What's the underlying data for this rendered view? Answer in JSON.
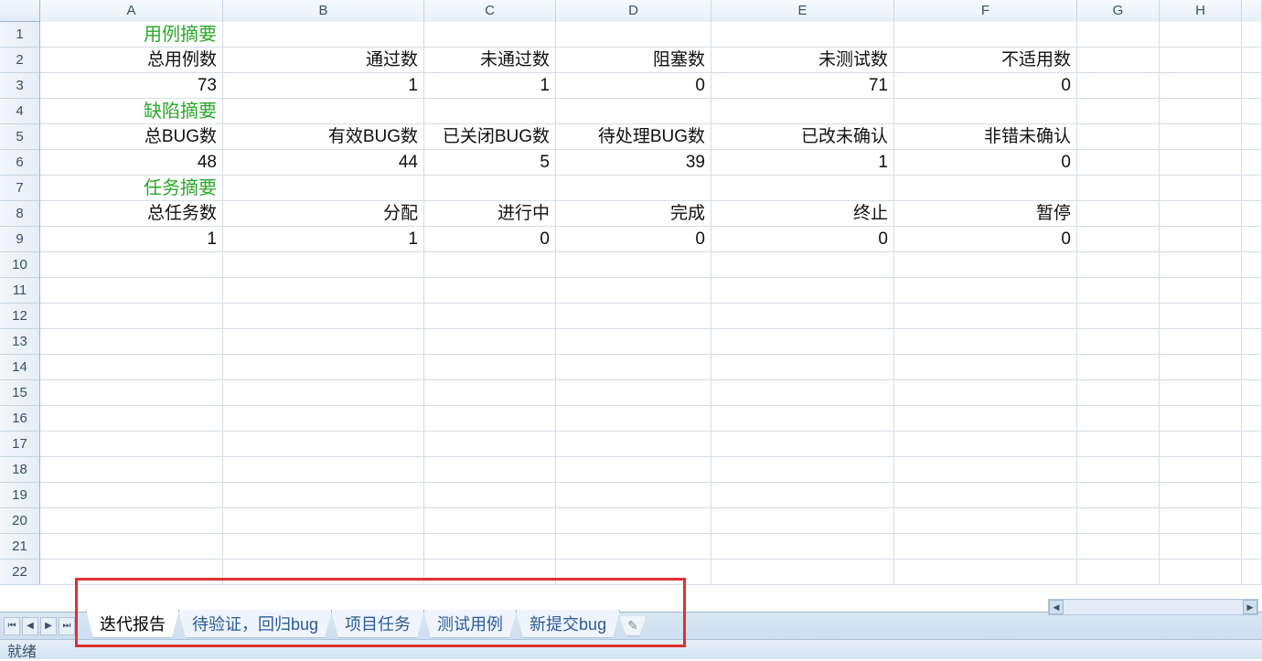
{
  "columns": [
    "A",
    "B",
    "C",
    "D",
    "E",
    "F",
    "G",
    "H"
  ],
  "col_widths": [
    "c-A",
    "c-B",
    "c-C",
    "c-D",
    "c-E",
    "c-F",
    "c-G",
    "c-H"
  ],
  "row_count": 22,
  "cells": {
    "r1": {
      "A": {
        "v": "用例摘要",
        "cls": "c-green"
      }
    },
    "r2": {
      "A": {
        "v": "总用例数"
      },
      "B": {
        "v": "通过数"
      },
      "C": {
        "v": "未通过数"
      },
      "D": {
        "v": "阻塞数"
      },
      "E": {
        "v": "未测试数"
      },
      "F": {
        "v": "不适用数"
      }
    },
    "r3": {
      "A": {
        "v": "73"
      },
      "B": {
        "v": "1"
      },
      "C": {
        "v": "1"
      },
      "D": {
        "v": "0"
      },
      "E": {
        "v": "71"
      },
      "F": {
        "v": "0"
      }
    },
    "r4": {
      "A": {
        "v": "缺陷摘要",
        "cls": "c-green"
      }
    },
    "r5": {
      "A": {
        "v": "总BUG数"
      },
      "B": {
        "v": "有效BUG数"
      },
      "C": {
        "v": "已关闭BUG数"
      },
      "D": {
        "v": "待处理BUG数"
      },
      "E": {
        "v": "已改未确认"
      },
      "F": {
        "v": "非错未确认"
      }
    },
    "r6": {
      "A": {
        "v": "48"
      },
      "B": {
        "v": "44"
      },
      "C": {
        "v": "5"
      },
      "D": {
        "v": "39"
      },
      "E": {
        "v": "1"
      },
      "F": {
        "v": "0"
      }
    },
    "r7": {
      "A": {
        "v": "任务摘要",
        "cls": "c-green"
      }
    },
    "r8": {
      "A": {
        "v": "总任务数"
      },
      "B": {
        "v": "分配"
      },
      "C": {
        "v": "进行中"
      },
      "D": {
        "v": "完成"
      },
      "E": {
        "v": "终止"
      },
      "F": {
        "v": "暂停"
      }
    },
    "r9": {
      "A": {
        "v": "1"
      },
      "B": {
        "v": "1"
      },
      "C": {
        "v": "0"
      },
      "D": {
        "v": "0"
      },
      "E": {
        "v": "0"
      },
      "F": {
        "v": "0"
      }
    }
  },
  "sheet_tabs": [
    "迭代报告",
    "待验证，回归bug",
    "项目任务",
    "测试用例",
    "新提交bug"
  ],
  "active_tab_index": 0,
  "nav_icons": [
    "⏮",
    "◀",
    "▶",
    "⏭"
  ],
  "status_text": "就绪",
  "tab_add_icon": "✎"
}
